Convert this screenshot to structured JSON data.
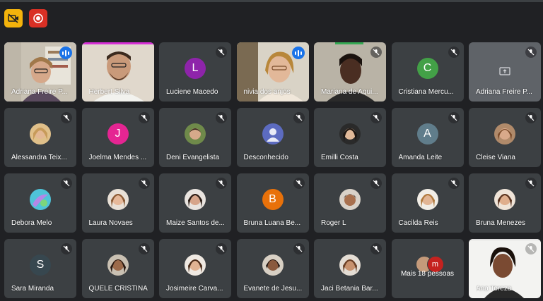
{
  "controls": {
    "camera_icon": "camera-off-icon",
    "record_icon": "record-icon"
  },
  "participants": [
    {
      "name": "Adriana Freire P..."
    },
    {
      "name": "Herbert Silva"
    },
    {
      "name": "Luciene Macedo",
      "initial": "L"
    },
    {
      "name": "nivia dos anjos"
    },
    {
      "name": "Mariana de Aqui..."
    },
    {
      "name": "Cristiana Mercu...",
      "initial": "C"
    },
    {
      "name": "Adriana Freire P..."
    },
    {
      "name": "Alessandra Teix..."
    },
    {
      "name": "Joelma Mendes ...",
      "initial": "J"
    },
    {
      "name": "Deni Evangelista"
    },
    {
      "name": "Desconhecido"
    },
    {
      "name": "Emilli Costa"
    },
    {
      "name": "Amanda Leite",
      "initial": "A"
    },
    {
      "name": "Cleise Viana"
    },
    {
      "name": "Debora Melo"
    },
    {
      "name": "Laura Novaes"
    },
    {
      "name": "Maize Santos de..."
    },
    {
      "name": "Bruna Luana Be...",
      "initial": "B"
    },
    {
      "name": "Roger L"
    },
    {
      "name": "Cacilda Reis"
    },
    {
      "name": "Bruna Menezes"
    },
    {
      "name": "Sara Miranda",
      "initial": "S"
    },
    {
      "name": "QUELE CRISTINA"
    },
    {
      "name": "Josimeire Carva..."
    },
    {
      "name": "Evanete de Jesu..."
    },
    {
      "name": "Jaci Betania Bar..."
    },
    {
      "more_label": "Mais 18 pessoas",
      "more_initial": "m"
    },
    {
      "name": "Ana Tereza"
    }
  ],
  "colors": {
    "background": "#202124",
    "tile": "#3c4043",
    "active_border": "#8ab4f8",
    "speaking": "#1a73e8",
    "luciene": "#8e24aa",
    "cristiana": "#43a047",
    "joelma": "#e52592",
    "amanda": "#607d8b",
    "bruna": "#e8710a",
    "sara": "#37474f"
  }
}
